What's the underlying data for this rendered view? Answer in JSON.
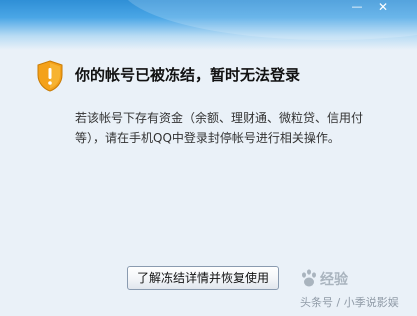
{
  "window": {
    "minimize_glyph": "—",
    "close_glyph": "✕"
  },
  "alert": {
    "icon": "warning-shield-icon",
    "headline": "你的帐号已被冻结，暂时无法登录",
    "description": "若该帐号下存有资金（余额、理财通、微粒贷、信用付等），请在手机QQ中登录封停帐号进行相关操作。"
  },
  "actions": {
    "learn_more_label": "了解冻结详情并恢复使用"
  },
  "watermarks": {
    "baidu_text": "经验",
    "author_text": "头条号 / 小季说影娱"
  },
  "colors": {
    "titlebar_top": "#2f8fd6",
    "dialog_bg": "#eaf1f8",
    "shield_orange": "#f4a11a"
  }
}
